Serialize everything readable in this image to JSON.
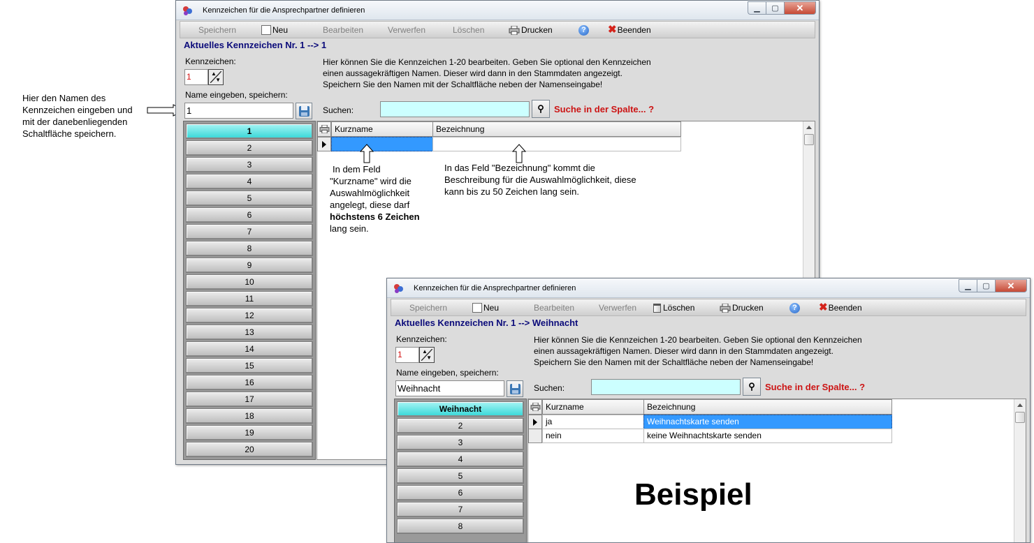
{
  "callout_left": {
    "lines": [
      "Hier den Namen des",
      "Kennzeichen eingeben und",
      "mit der danebenliegenden",
      "Schaltfläche speichern."
    ]
  },
  "win1": {
    "title": "Kennzeichen für die Ansprechpartner definieren",
    "toolbar": {
      "save": "Speichern",
      "new": "Neu",
      "edit": "Bearbeiten",
      "discard": "Verwerfen",
      "delete": "Löschen",
      "print": "Drucken",
      "help": "?",
      "quit": "Beenden"
    },
    "heading": "Aktuelles Kennzeichen Nr. 1  -->  1",
    "kennzeichen_label": "Kennzeichen:",
    "kennzeichen_value": "1",
    "name_label": "Name eingeben, speichern:",
    "name_value": "1",
    "info_lines": [
      "Hier können Sie die Kennzeichen 1-20 bearbeiten. Geben Sie optional den Kennzeichen",
      "einen aussagekräftigen Namen. Dieser wird dann in den Stammdaten angezeigt.",
      "Speichern Sie den Namen mit der Schaltfläche neben der Namenseingabe!"
    ],
    "search_label": "Suchen:",
    "search_value": "",
    "search_hint": "Suche in der Spalte... ?",
    "tabs": [
      "1",
      "2",
      "3",
      "4",
      "5",
      "6",
      "7",
      "8",
      "9",
      "10",
      "11",
      "12",
      "13",
      "14",
      "15",
      "16",
      "17",
      "18",
      "19",
      "20"
    ],
    "grid": {
      "headers": [
        "Kurzname",
        "Bezeichnung"
      ],
      "rows": [
        [
          "",
          ""
        ]
      ]
    },
    "annotation_kurzname": {
      "lines": [
        "In dem Feld",
        "\"Kurzname\" wird die",
        "Auswahlmöglichkeit",
        "angelegt, diese darf"
      ],
      "bold": "höchstens 6 Zeichen",
      "last": "lang sein."
    },
    "annotation_bezeichnung": {
      "lines": [
        "In das Feld \"Bezeichnung\" kommt die",
        "Beschreibung für die Auswahlmöglichkeit, diese",
        "kann bis zu 50 Zeichen lang sein."
      ]
    }
  },
  "win2": {
    "title": "Kennzeichen für die Ansprechpartner definieren",
    "toolbar": {
      "save": "Speichern",
      "new": "Neu",
      "edit": "Bearbeiten",
      "discard": "Verwerfen",
      "delete": "Löschen",
      "print": "Drucken",
      "help": "?",
      "quit": "Beenden"
    },
    "heading": "Aktuelles Kennzeichen Nr. 1  -->  Weihnacht",
    "kennzeichen_label": "Kennzeichen:",
    "kennzeichen_value": "1",
    "name_label": "Name eingeben, speichern:",
    "name_value": "Weihnacht",
    "info_lines": [
      "Hier können Sie die Kennzeichen 1-20 bearbeiten. Geben Sie optional den Kennzeichen",
      "einen aussagekräftigen Namen. Dieser wird dann in den Stammdaten angezeigt.",
      "Speichern Sie den Namen mit der Schaltfläche neben der Namenseingabe!"
    ],
    "search_label": "Suchen:",
    "search_value": "",
    "search_hint": "Suche in der Spalte... ?",
    "tabs": [
      "Weihnacht",
      "2",
      "3",
      "4",
      "5",
      "6",
      "7",
      "8"
    ],
    "grid": {
      "headers": [
        "Kurzname",
        "Bezeichnung"
      ],
      "rows": [
        [
          "ja",
          "Weihnachtskarte senden"
        ],
        [
          "nein",
          "keine Weihnachtskarte senden"
        ]
      ]
    },
    "overlay": "Beispiel"
  },
  "colors": {
    "heading": "#0b0b7a",
    "hint": "#cc1414",
    "active_tab": "#38d8d8",
    "search_bg": "#ccffff",
    "selection": "#3399ff"
  }
}
